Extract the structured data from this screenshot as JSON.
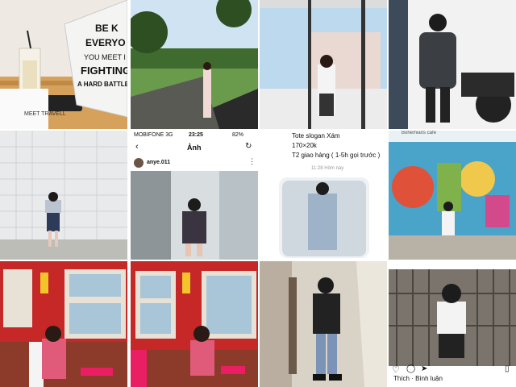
{
  "collage": {
    "tiles": [
      {
        "id": "cafe-table-tote",
        "overlay": {
          "bag_lines": [
            "BE K",
            "EVERYO",
            "YOU MEET I",
            "FIGHTING",
            "A HARD BATTLE"
          ],
          "book": "MEET TRAVELL"
        }
      },
      {
        "id": "park-walkway",
        "overlay": {}
      },
      {
        "id": "window-view",
        "overlay": {}
      },
      {
        "id": "motorbike-rider",
        "overlay": {}
      },
      {
        "id": "white-wall-outfit",
        "overlay": {}
      },
      {
        "id": "phone-screenshot",
        "overlay": {
          "carrier": "MOBIFONE 3G",
          "time": "23:25",
          "battery": "82%",
          "title": "Ảnh",
          "username": "anye.011"
        }
      },
      {
        "id": "chat-screenshot",
        "overlay": {
          "line1": "Tote slogan Xám",
          "line2": "170×20k",
          "line3": "T2 giao hàng ( 1-5h gọi trước )",
          "stamp": "11:28 Hôm nay"
        }
      },
      {
        "id": "graffiti-wall",
        "overlay": {
          "label": "Bohemians cafe"
        }
      },
      {
        "id": "red-window-1",
        "overlay": {}
      },
      {
        "id": "red-window-2",
        "overlay": {}
      },
      {
        "id": "alley-tote",
        "overlay": {}
      },
      {
        "id": "gate-outfit",
        "overlay": {
          "actions": "Thích · Bình luận"
        }
      }
    ]
  },
  "colors": {
    "brick": "#8c3a2a",
    "red_frame": "#c62828",
    "sky": "#cfe3f2",
    "wall_white": "#e9eaec",
    "graffiti": "#4aa3c8",
    "grass": "#4c7a3a"
  }
}
